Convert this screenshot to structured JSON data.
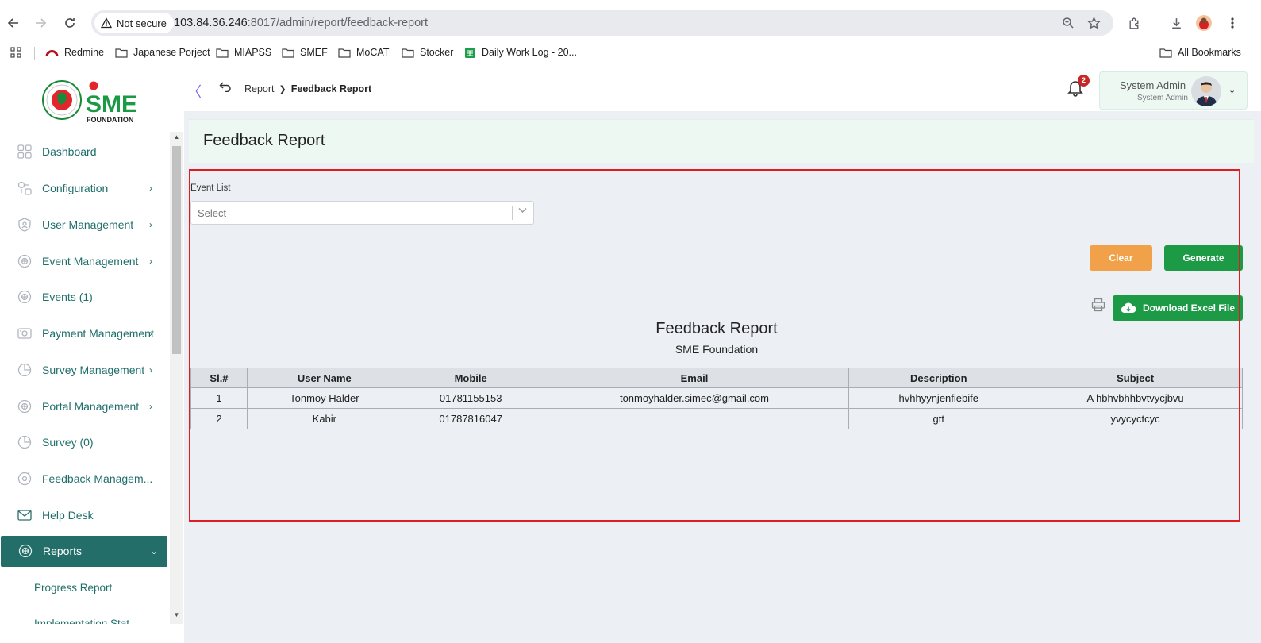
{
  "browser": {
    "security_label": "Not secure",
    "url_host": "103.84.36.246",
    "url_rest": ":8017/admin/report/feedback-report",
    "bookmarks": [
      {
        "label": "Redmine",
        "icon": "redmine-icon"
      },
      {
        "label": "Japanese Porject",
        "icon": "folder-icon"
      },
      {
        "label": "MIAPSS",
        "icon": "folder-icon"
      },
      {
        "label": "SMEF",
        "icon": "folder-icon"
      },
      {
        "label": "MoCAT",
        "icon": "folder-icon"
      },
      {
        "label": "Stocker",
        "icon": "folder-icon"
      },
      {
        "label": "Daily Work Log - 20...",
        "icon": "sheets-icon"
      }
    ],
    "all_bookmarks": "All Bookmarks"
  },
  "logo": {
    "text_sme": "SME",
    "text_foundation": "FOUNDATION"
  },
  "sidebar": {
    "items": [
      {
        "label": "Dashboard",
        "icon": "dashboard-icon",
        "has_children": false
      },
      {
        "label": "Configuration",
        "icon": "configuration-icon",
        "has_children": true
      },
      {
        "label": "User Management",
        "icon": "shield-icon",
        "has_children": true
      },
      {
        "label": "Event Management",
        "icon": "event-icon",
        "has_children": true
      },
      {
        "label": "Events (1)",
        "icon": "event-icon",
        "has_children": false
      },
      {
        "label": "Payment Management",
        "icon": "payment-icon",
        "has_children": true
      },
      {
        "label": "Survey Management",
        "icon": "pie-icon",
        "has_children": true
      },
      {
        "label": "Portal Management",
        "icon": "portal-icon",
        "has_children": true
      },
      {
        "label": "Survey (0)",
        "icon": "pie-icon",
        "has_children": false
      },
      {
        "label": "Feedback Managem...",
        "icon": "feedback-icon",
        "has_children": false
      },
      {
        "label": "Help Desk",
        "icon": "mail-icon",
        "has_children": false
      },
      {
        "label": "Reports",
        "icon": "reports-icon",
        "has_children": true,
        "active": true
      }
    ],
    "sub_items": [
      "Progress Report",
      "Implementation Stat..."
    ]
  },
  "topbar": {
    "breadcrumb": [
      "Report",
      "Feedback Report"
    ],
    "notification_count": "2",
    "user_name": "System Admin",
    "user_role": "System Admin"
  },
  "page": {
    "title": "Feedback Report",
    "filter_label": "Event List",
    "select_placeholder": "Select",
    "clear_label": "Clear",
    "generate_label": "Generate",
    "download_label": "Download Excel File",
    "report_title": "Feedback Report",
    "report_subtitle": "SME Foundation"
  },
  "table": {
    "columns": [
      "Sl.#",
      "User Name",
      "Mobile",
      "Email",
      "Description",
      "Subject"
    ],
    "rows": [
      [
        "1",
        "Tonmoy Halder",
        "01781155153",
        "tonmoyhalder.simec@gmail.com",
        "hvhhyynjenfiebife",
        "A hbhvbhhbvtvycjbvu"
      ],
      [
        "2",
        "Kabir",
        "01787816047",
        "",
        "gtt",
        "yvycyctcyc"
      ]
    ]
  },
  "colors": {
    "brand_green": "#236e68",
    "button_green": "#1c9a46",
    "button_orange": "#f0a14a",
    "highlight_red": "#e11b22"
  }
}
